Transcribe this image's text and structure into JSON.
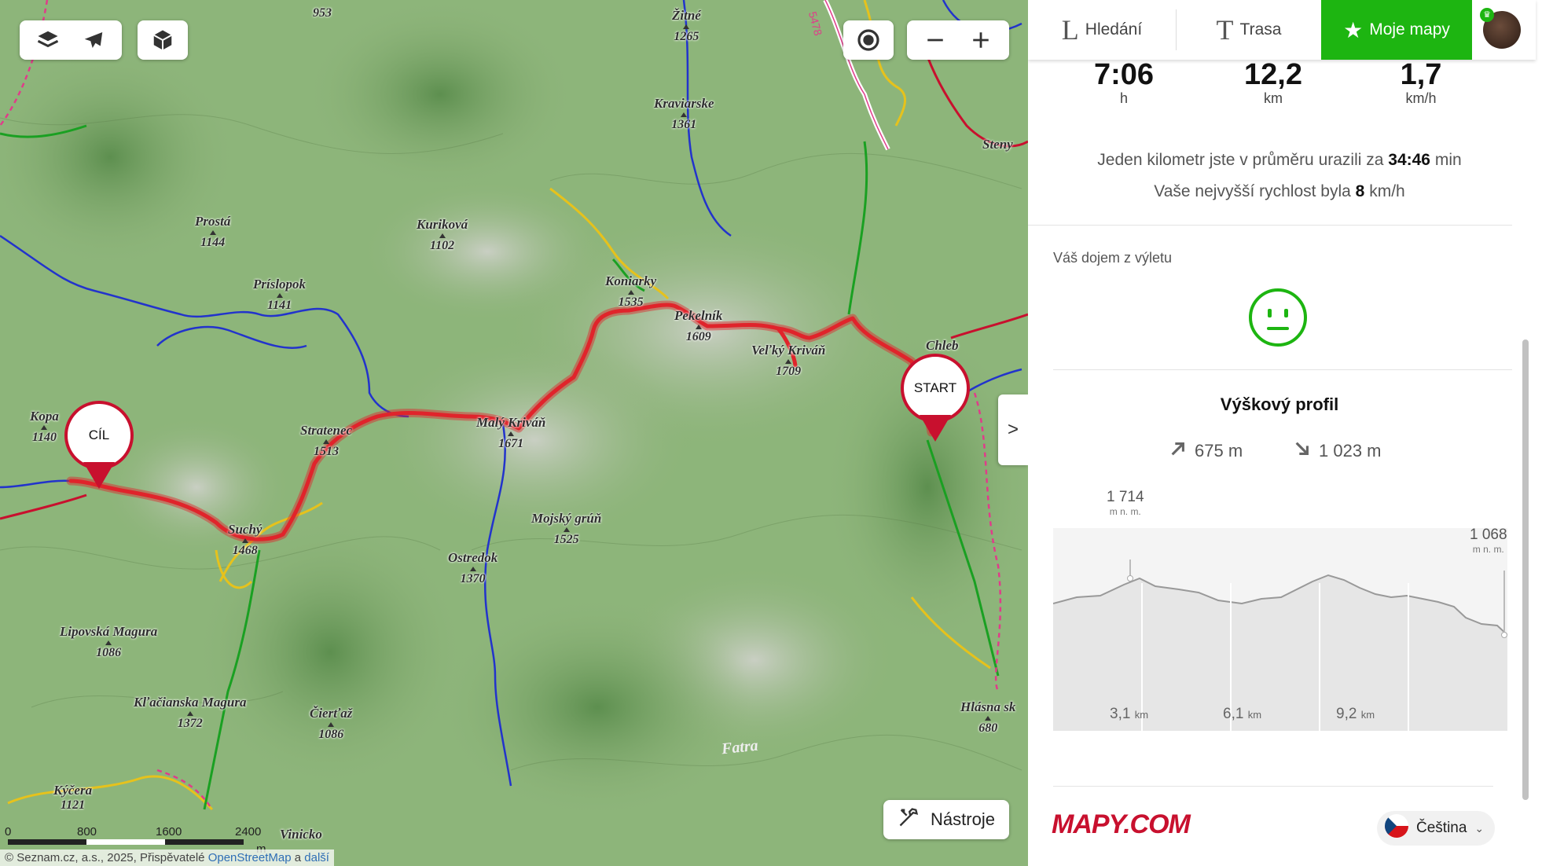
{
  "map": {
    "peaks": [
      {
        "name": "",
        "elev": "953"
      },
      {
        "name": "Žitné",
        "elev": "1265"
      },
      {
        "name": "Kraviarske",
        "elev": "1361"
      },
      {
        "name": "Prostá",
        "elev": "1144"
      },
      {
        "name": "Kuriková",
        "elev": "1102"
      },
      {
        "name": "Príslopok",
        "elev": "1141"
      },
      {
        "name": "Koniarky",
        "elev": "1535"
      },
      {
        "name": "Pekelník",
        "elev": "1609"
      },
      {
        "name": "Veľký Kriváň",
        "elev": "1709"
      },
      {
        "name": "Steny",
        "elev": ""
      },
      {
        "name": "Chleb",
        "elev": ""
      },
      {
        "name": "Kopa",
        "elev": "1140"
      },
      {
        "name": "Stratenec",
        "elev": "1513"
      },
      {
        "name": "Malý Kriváň",
        "elev": "1671"
      },
      {
        "name": "Suchý",
        "elev": "1468"
      },
      {
        "name": "Mojský grúň",
        "elev": "1525"
      },
      {
        "name": "Ostredok",
        "elev": "1370"
      },
      {
        "name": "Lipovská Magura",
        "elev": "1086"
      },
      {
        "name": "Kľačianska Magura",
        "elev": "1372"
      },
      {
        "name": "Čierťaž",
        "elev": "1086"
      },
      {
        "name": "Hlásna sk",
        "elev": "680"
      },
      {
        "name": "Kýčera",
        "elev": "1121"
      },
      {
        "name": "Vinicko",
        "elev": ""
      }
    ],
    "road_number": "5478",
    "area_label": "Fatra",
    "start_label": "START",
    "finish_label": "CÍL",
    "scale": {
      "labels": [
        "0",
        "800",
        "1600",
        "2400"
      ],
      "unit": "m"
    },
    "attribution": {
      "text": "© Seznam.cz, a.s., 2025, Přispěvatelé",
      "osm": "OpenStreetMap",
      "and": "a",
      "more": "další"
    },
    "tools_label": "Nástroje",
    "expand_label": ">",
    "icons": [
      "layers-icon",
      "airplane-icon",
      "cube-3d-icon",
      "locate-icon",
      "zoom-out-icon",
      "zoom-in-icon",
      "tools-icon"
    ],
    "route_color": "#e0242b"
  },
  "panel": {
    "tabs": [
      {
        "glyph": "L",
        "label": "Hledání"
      },
      {
        "glyph": "T",
        "label": "Trasa"
      },
      {
        "glyph": "★",
        "label": "Moje mapy"
      }
    ],
    "stats": [
      {
        "value": "7:06",
        "unit": "h"
      },
      {
        "value": "12,2",
        "unit": "km"
      },
      {
        "value": "1,7",
        "unit": "km/h"
      }
    ],
    "avg_prefix": "Jeden kilometr jste v průměru urazili za",
    "avg_value": "34:46",
    "avg_unit": "min",
    "max_prefix": "Vaše nejvyšší rychlost byla",
    "max_value": "8",
    "max_unit": "km/h",
    "impression_label": "Váš dojem z výletu",
    "profile": {
      "title": "Výškový profil",
      "ascent": "675 m",
      "descent": "1 023 m",
      "max_label": "1 714",
      "max_unit": "m n. m.",
      "end_label": "1 068",
      "end_unit": "m n. m.",
      "km_ticks": [
        {
          "v": "3,1",
          "u": "km"
        },
        {
          "v": "6,1",
          "u": "km"
        },
        {
          "v": "9,2",
          "u": "km"
        }
      ]
    },
    "logo": "MAPY.COM",
    "language": "Čeština",
    "accent": "#1db511"
  }
}
